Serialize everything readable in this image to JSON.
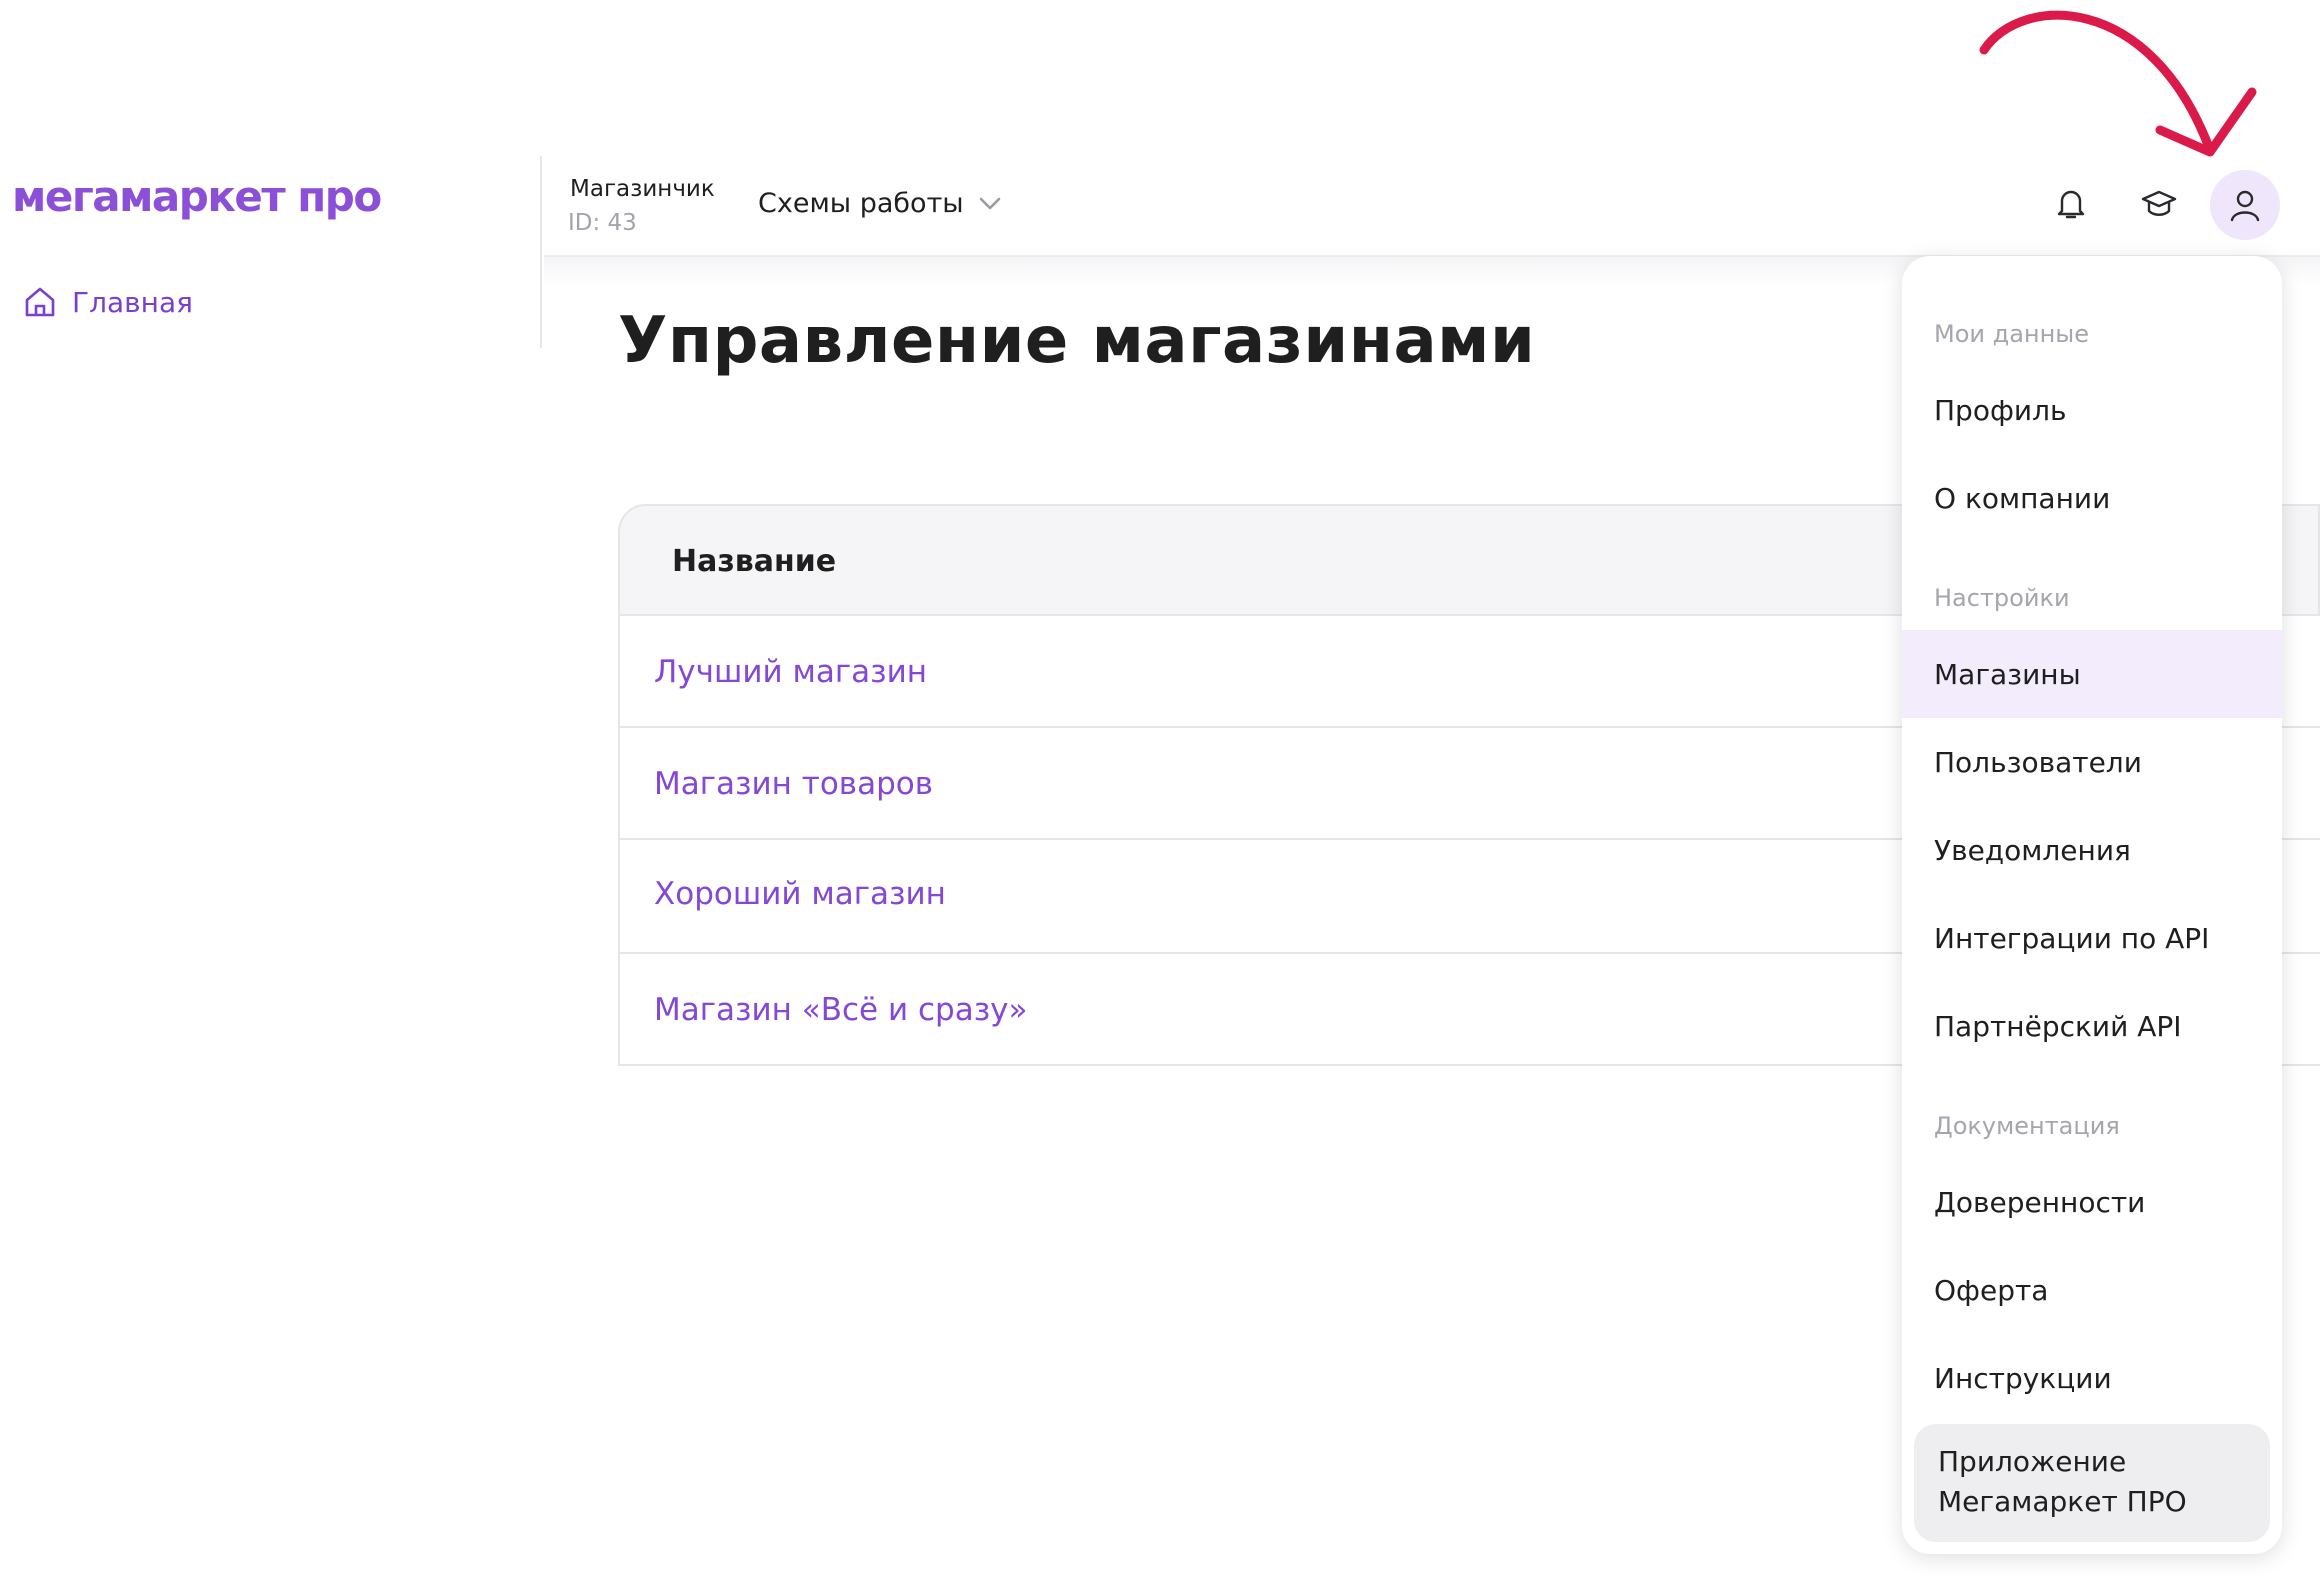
{
  "brand": {
    "logo": "мегамаркет про",
    "accent": "#8b4fd8",
    "annotation_color": "#dc1a4a"
  },
  "sidebar": {
    "items": [
      {
        "label": "Главная",
        "icon": "home-icon"
      }
    ]
  },
  "header": {
    "store_name": "Магазинчик",
    "store_id": "ID: 43",
    "schemes_label": "Схемы работы",
    "icons": [
      "bell-icon",
      "graduation-cap-icon",
      "user-icon"
    ]
  },
  "main": {
    "title": "Управление магазинами",
    "table": {
      "column": "Название",
      "rows": [
        "Лучший магазин",
        "Магазин товаров",
        "Хороший магазин",
        "Магазин «Всё и сразу»"
      ]
    }
  },
  "menu": {
    "sections": [
      {
        "title": "Мои данные",
        "items": [
          "Профиль",
          "О компании"
        ]
      },
      {
        "title": "Настройки",
        "items": [
          "Магазины",
          "Пользователи",
          "Уведомления",
          "Интеграции по API",
          "Партнёрский API"
        ]
      },
      {
        "title": "Документация",
        "items": [
          "Доверенности",
          "Оферта",
          "Инструкции"
        ]
      }
    ],
    "active_item": "Магазины",
    "app_card": "Приложение Мегамаркет ПРО"
  }
}
